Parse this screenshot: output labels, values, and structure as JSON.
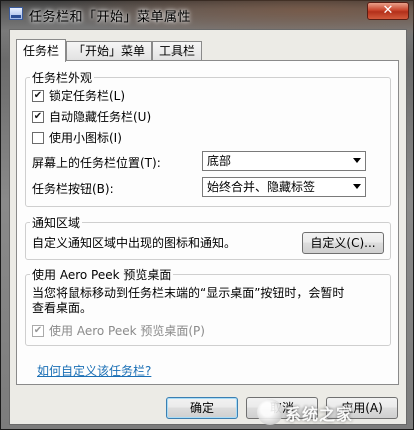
{
  "window": {
    "title": "任务栏和「开始」菜单属性",
    "close_label": "✕"
  },
  "tabs": [
    {
      "label": "任务栏",
      "active": true
    },
    {
      "label": "「开始」菜单",
      "active": false
    },
    {
      "label": "工具栏",
      "active": false
    }
  ],
  "appearance": {
    "group_title": "任务栏外观",
    "checkboxes": [
      {
        "label": "锁定任务栏(L)",
        "checked": true
      },
      {
        "label": "自动隐藏任务栏(U)",
        "checked": true
      },
      {
        "label": "使用小图标(I)",
        "checked": false
      }
    ],
    "position_label": "屏幕上的任务栏位置(T):",
    "position_value": "底部",
    "buttons_label": "任务栏按钮(B):",
    "buttons_value": "始终合并、隐藏标签"
  },
  "notification": {
    "group_title": "通知区域",
    "description": "自定义通知区域中出现的图标和通知。",
    "customize_label": "自定义(C)..."
  },
  "aero_peek": {
    "group_title": "使用 Aero Peek 预览桌面",
    "description_line1": "当您将鼠标移动到任务栏末端的“显示桌面”按钮时，会暂时",
    "description_line2": "查看桌面。",
    "checkbox_label": "使用 Aero Peek 预览桌面(P)",
    "checkbox_checked": true,
    "checkbox_disabled": true
  },
  "help_link": "如何自定义该任务栏?",
  "footer": {
    "ok_label": "确定",
    "cancel_label": "取消",
    "apply_label": "应用(A)"
  },
  "watermark": {
    "text": "系统之家"
  }
}
